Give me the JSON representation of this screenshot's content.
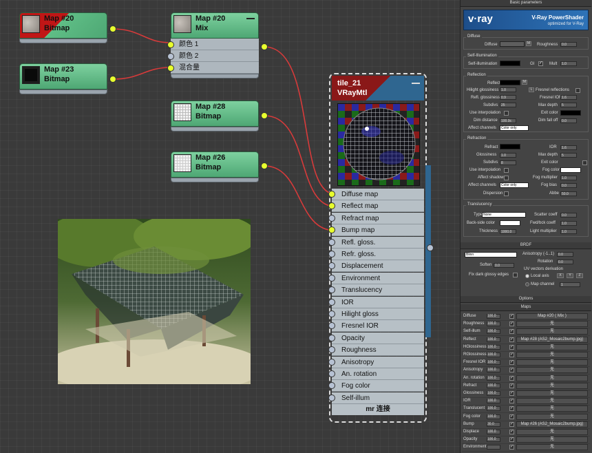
{
  "nodes": {
    "map20_bitmap": {
      "title": "Map #20",
      "subtitle": "Bitmap"
    },
    "map23_bitmap": {
      "title": "Map #23",
      "subtitle": "Bitmap"
    },
    "map20_mix": {
      "title": "Map #20",
      "subtitle": "Mix",
      "inputs": [
        "颜色 1",
        "颜色 2",
        "混合量"
      ]
    },
    "map28_bitmap": {
      "title": "Map #28",
      "subtitle": "Bitmap"
    },
    "map26_bitmap": {
      "title": "Map #26",
      "subtitle": "Bitmap"
    }
  },
  "material": {
    "name": "tile_21",
    "type": "VRayMtl",
    "slots": [
      {
        "label": "Diffuse map",
        "connected": true
      },
      {
        "label": "Reflect map",
        "connected": true
      },
      {
        "label": "Refract map",
        "connected": false
      },
      {
        "label": "Bump map",
        "connected": true
      },
      {
        "label": "Refl. gloss.",
        "connected": false
      },
      {
        "label": "Refr. gloss.",
        "connected": false
      },
      {
        "label": "Displacement",
        "connected": false
      },
      {
        "label": "Environment",
        "connected": false
      },
      {
        "label": "Translucency",
        "connected": false
      },
      {
        "label": "IOR",
        "connected": false
      },
      {
        "label": "Hilight gloss",
        "connected": false
      },
      {
        "label": "Fresnel IOR",
        "connected": false
      },
      {
        "label": "Opacity",
        "connected": false
      },
      {
        "label": "Roughness",
        "connected": false
      },
      {
        "label": "Anisotropy",
        "connected": false
      },
      {
        "label": "An. rotation",
        "connected": false
      },
      {
        "label": "Fog color",
        "connected": false
      },
      {
        "label": "Self-illum",
        "connected": false
      }
    ],
    "footer": "mr 连接"
  },
  "panel": {
    "basic_title": "Basic parameters",
    "banner": {
      "brand": "v·ray",
      "title": "V-Ray PowerShader",
      "subtitle": "optimized for V-Ray"
    },
    "diffuse": {
      "group": "Diffuse",
      "diffuse_label": "Diffuse",
      "m": "M",
      "roughness_label": "Roughness",
      "roughness": "0.0"
    },
    "selfillum": {
      "group": "Self-Illumination",
      "label": "Self-illumination",
      "gi": "GI",
      "mult_label": "Mult",
      "mult": "1.0"
    },
    "reflection": {
      "group": "Reflection",
      "reflect": "Reflect",
      "m": "M",
      "hilight_label": "Hilight glossiness",
      "hilight": "1.0",
      "l": "L",
      "fresnel_label": "Fresnel reflections",
      "refl_gloss_label": "Refl. glossiness",
      "refl_gloss": "0.9",
      "fresnel_ior_label": "Fresnel IOR",
      "fresnel_ior": "1.6",
      "subdivs_label": "Subdivs",
      "subdivs": "25",
      "max_depth_label": "Max depth",
      "max_depth": "5",
      "use_interp": "Use interpolation",
      "exit_color": "Exit color",
      "dim_dist_label": "Dim distance",
      "dim_dist": "100.0c",
      "dim_falloff_label": "Dim fall off",
      "dim_falloff": "0.0",
      "affect_label": "Affect channels",
      "affect": "Color only"
    },
    "refraction": {
      "group": "Refraction",
      "refract": "Refract",
      "ior_label": "IOR",
      "ior": "1.6",
      "gloss_label": "Glossiness",
      "gloss": "1.0",
      "max_depth_label": "Max depth",
      "max_depth": "5",
      "subdivs_label": "Subdivs",
      "subdivs": "8",
      "exit_color": "Exit color",
      "use_interp": "Use interpolation",
      "fog_color": "Fog color",
      "affect_shadows": "Affect shadows",
      "fog_mult_label": "Fog multiplier",
      "fog_mult": "1.0",
      "affect_label": "Affect channels",
      "affect": "Color only",
      "fog_bias_label": "Fog bias",
      "fog_bias": "0.0",
      "dispersion": "Dispersion",
      "abbe_label": "Abbe",
      "abbe": "50.0"
    },
    "translucency": {
      "group": "Translucency",
      "type_label": "Type",
      "type": "None",
      "scatter_label": "Scatter coeff",
      "scatter": "0.0",
      "backside_label": "Back-side color",
      "fwdbck_label": "Fwd/bck coeff",
      "fwdbck": "1.0",
      "thickness_label": "Thickness",
      "thickness": "1000.0",
      "light_mult_label": "Light multiplier",
      "light_mult": "1.0"
    },
    "brdf": {
      "title": "BRDF",
      "type": "Blinn",
      "aniso_label": "Anisotropy (-1..1)",
      "aniso": "0.0",
      "rotation_label": "Rotation",
      "rotation": "0.0",
      "soften_label": "Soften",
      "soften": "0.0",
      "uv_label": "UV vectors derivation",
      "fix_label": "Fix dark glossy edges",
      "local_axis": "Local axis",
      "x": "X",
      "y": "Y",
      "z": "Z",
      "map_channel_label": "Map channel",
      "map_channel": "1"
    },
    "options_title": "Options",
    "maps_title": "Maps",
    "maps": [
      {
        "name": "Diffuse",
        "amount": "100.0",
        "map": "Map #20  ( Mix )"
      },
      {
        "name": "Roughness",
        "amount": "100.0",
        "map": "无"
      },
      {
        "name": "Self-illum",
        "amount": "100.0",
        "map": "无"
      },
      {
        "name": "Reflect",
        "amount": "100.0",
        "map": "Map #28 (AS2_Mosaic2bump.jpg)"
      },
      {
        "name": "HGlossiness",
        "amount": "100.0",
        "map": "无"
      },
      {
        "name": "RGlossiness",
        "amount": "100.0",
        "map": "无"
      },
      {
        "name": "Fresnel IOR",
        "amount": "100.0",
        "map": "无"
      },
      {
        "name": "Anisotropy",
        "amount": "100.0",
        "map": "无"
      },
      {
        "name": "An. rotation",
        "amount": "100.0",
        "map": "无"
      },
      {
        "name": "Refract",
        "amount": "100.0",
        "map": "无"
      },
      {
        "name": "Glossiness",
        "amount": "100.0",
        "map": "无"
      },
      {
        "name": "IOR",
        "amount": "100.0",
        "map": "无"
      },
      {
        "name": "Translucent",
        "amount": "100.0",
        "map": "无"
      },
      {
        "name": "Fog color",
        "amount": "100.0",
        "map": "无"
      },
      {
        "name": "Bump",
        "amount": "30.0",
        "map": "Map #26 (AS2_Mosaic2bump.jpg)"
      },
      {
        "name": "Displace",
        "amount": "100.0",
        "map": "无"
      },
      {
        "name": "Opacity",
        "amount": "100.0",
        "map": "无"
      },
      {
        "name": "Environment",
        "amount": "",
        "map": "无"
      }
    ]
  }
}
